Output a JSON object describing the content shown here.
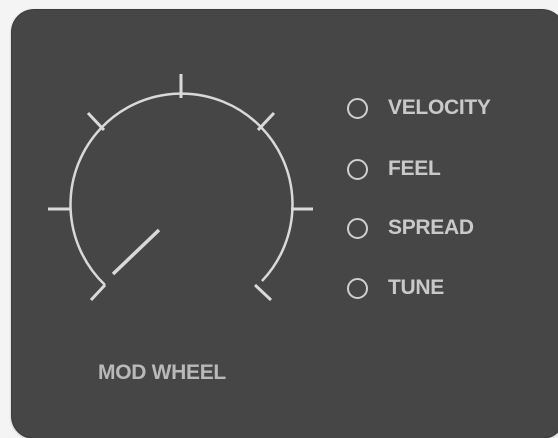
{
  "knob": {
    "label": "MOD WHEEL",
    "tick_count": 7
  },
  "options": [
    {
      "label": "VELOCITY",
      "selected": false
    },
    {
      "label": "FEEL",
      "selected": false
    },
    {
      "label": "SPREAD",
      "selected": false
    },
    {
      "label": "TUNE",
      "selected": false
    }
  ],
  "colors": {
    "panel": "#464646",
    "stroke": "#d9d9d9",
    "text": "#c9c9c9"
  }
}
